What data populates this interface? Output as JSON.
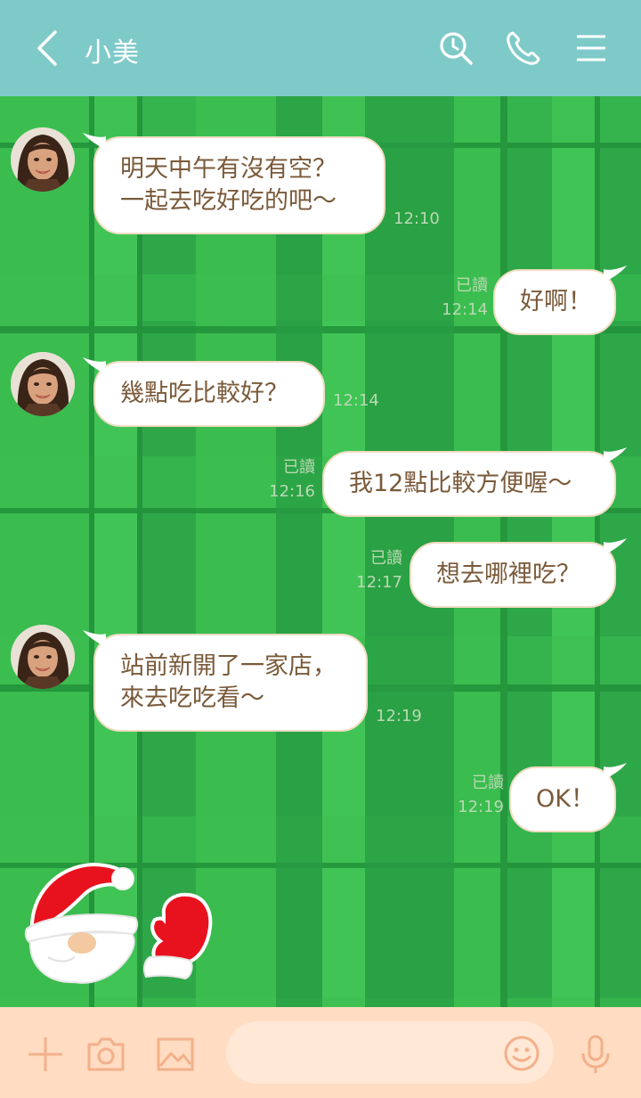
{
  "header": {
    "title": "小美",
    "back_icon": "chevron-left-icon",
    "search_icon": "search-icon",
    "call_icon": "phone-icon",
    "menu_icon": "menu-icon",
    "color": "#7ecac9"
  },
  "messages": [
    {
      "side": "left",
      "lines": [
        "明天中午有沒有空？",
        "一起去吃好吃的吧～"
      ],
      "time": "12:10"
    },
    {
      "side": "right",
      "lines": [
        "好啊！"
      ],
      "read": "已讀",
      "time": "12:14"
    },
    {
      "side": "left",
      "lines": [
        "幾點吃比較好？"
      ],
      "time": "12:14"
    },
    {
      "side": "right",
      "lines": [
        "我12點比較方便喔～"
      ],
      "read": "已讀",
      "time": "12:16"
    },
    {
      "side": "right",
      "lines": [
        "想去哪裡吃？"
      ],
      "read": "已讀",
      "time": "12:17"
    },
    {
      "side": "left",
      "lines": [
        "站前新開了一家店，",
        "來去吃吃看～"
      ],
      "time": "12:19"
    },
    {
      "side": "right",
      "lines": [
        "OK！"
      ],
      "read": "已讀",
      "time": "12:19"
    }
  ],
  "sticker": {
    "icon": "santa-mitten-sticker"
  },
  "footer": {
    "add_icon": "plus-icon",
    "camera_icon": "camera-icon",
    "image_icon": "image-icon",
    "emoji_icon": "smiley-icon",
    "mic_icon": "microphone-icon",
    "input_value": "",
    "color": "#ffdcc2"
  },
  "colors": {
    "plaid_base": "#2ea749",
    "plaid_light": "#3cc050",
    "bubble_text": "#7a5a3a",
    "meta_text": "#b9d9b3"
  }
}
